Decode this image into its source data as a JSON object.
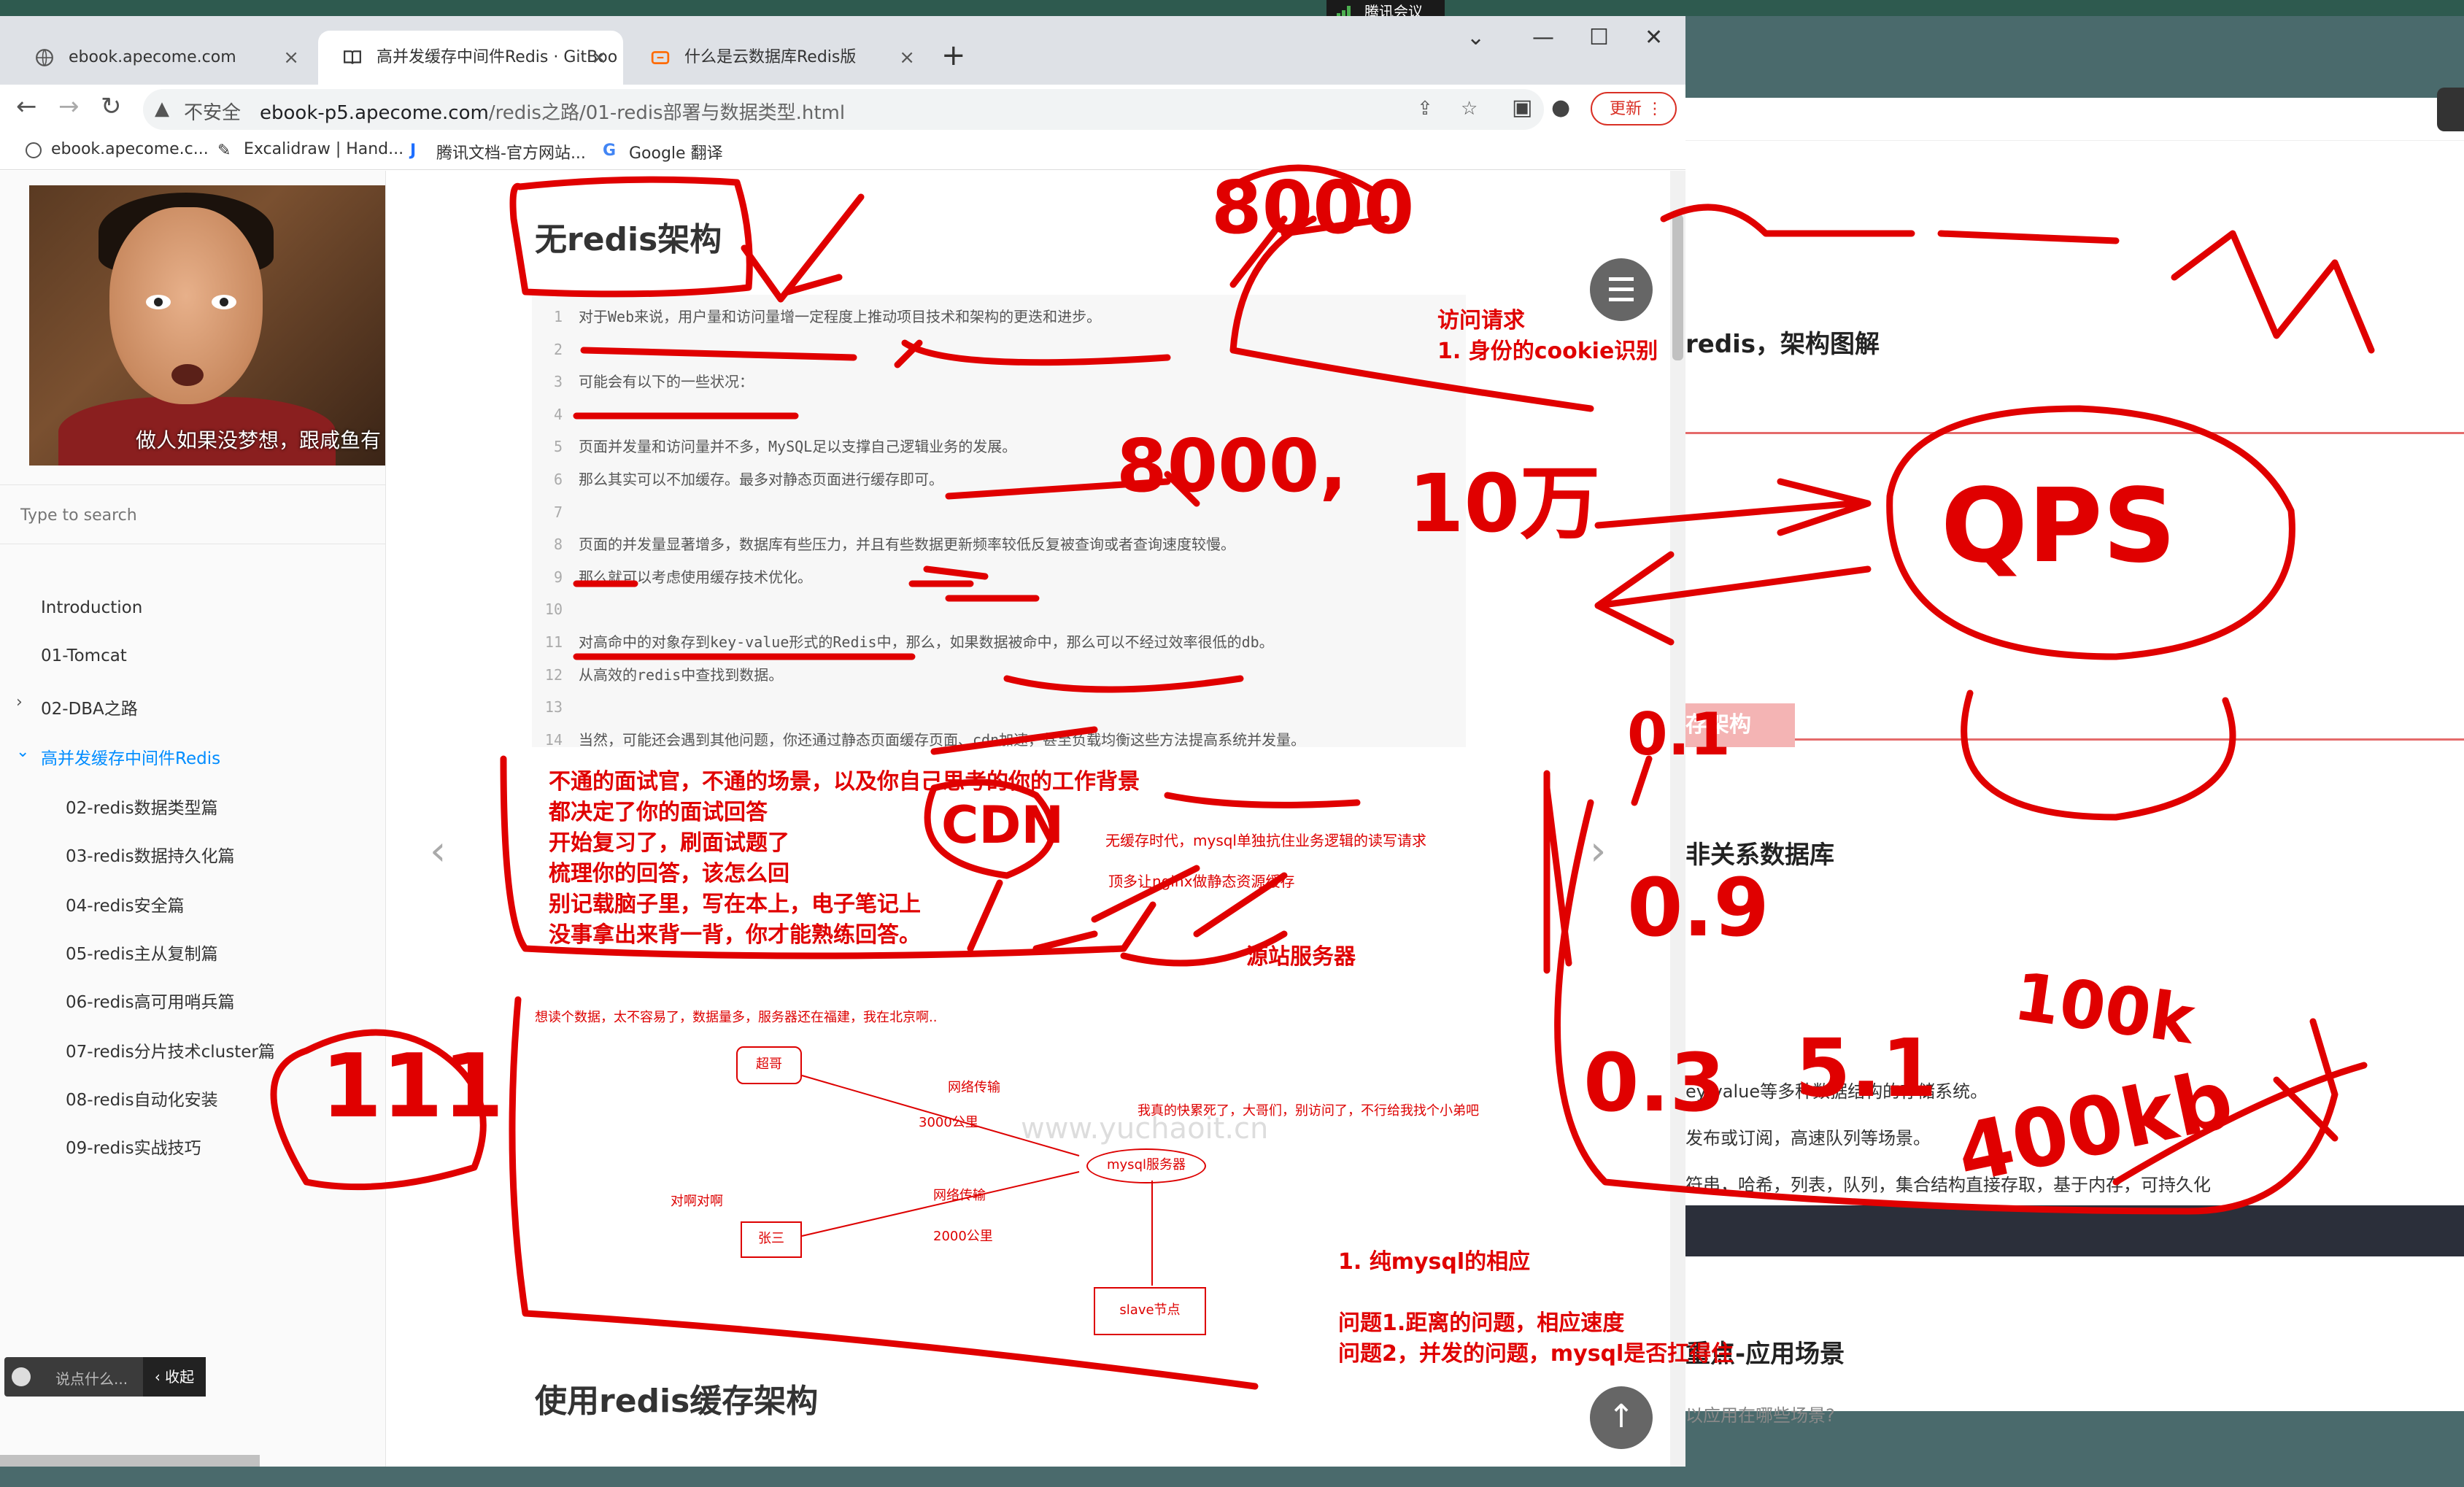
{
  "meeting": {
    "label": "腾讯会议"
  },
  "tabs": [
    {
      "label": "ebook.apecome.com",
      "icon": "globe-icon"
    },
    {
      "label": "高并发缓存中间件Redis · GitBoo",
      "icon": "book-icon",
      "active": true
    },
    {
      "label": "什么是云数据库Redis版",
      "icon": "aliyun-icon"
    }
  ],
  "toolbar": {
    "insecure": "不安全",
    "url_host": "ebook-p5.apecome.com",
    "url_path": "/redis之路/01-redis部署与数据类型.html",
    "update_label": "更新"
  },
  "bookmarks": [
    {
      "label": "ebook.apecome.c...",
      "icon": "globe-icon"
    },
    {
      "label": "Excalidraw | Hand...",
      "icon": "pen-icon"
    },
    {
      "label": "腾讯文档-官方网站...",
      "icon": "tencent-docs-icon"
    },
    {
      "label": "Google 翻译",
      "icon": "translate-icon"
    }
  ],
  "sidebar": {
    "avatar_caption": "做人如果没梦想，跟咸鱼有",
    "search_placeholder": "Type to search",
    "items": [
      {
        "label": "Introduction"
      },
      {
        "label": "01-Tomcat"
      },
      {
        "label": "02-DBA之路",
        "expandable": true
      },
      {
        "label": "高并发缓存中间件Redis",
        "active": true,
        "expanded": true
      },
      {
        "label": "02-redis数据类型篇"
      },
      {
        "label": "03-redis数据持久化篇"
      },
      {
        "label": "04-redis安全篇"
      },
      {
        "label": "05-redis主从复制篇"
      },
      {
        "label": "06-redis高可用哨兵篇"
      },
      {
        "label": "07-redis分片技术cluster篇"
      },
      {
        "label": "08-redis自动化安装"
      },
      {
        "label": "09-redis实战技巧"
      }
    ],
    "chat": {
      "placeholder": "说点什么...",
      "collapse": "收起"
    }
  },
  "main": {
    "title": "无redis架构",
    "code_lines": [
      {
        "n": "1",
        "text": "对于Web来说，用户量和访问量增一定程度上推动项目技术和架构的更迭和进步。"
      },
      {
        "n": "2",
        "text": ""
      },
      {
        "n": "3",
        "text": "可能会有以下的一些状况："
      },
      {
        "n": "4",
        "text": ""
      },
      {
        "n": "5",
        "text": "页面并发量和访问量并不多，MySQL足以支撑自己逻辑业务的发展。"
      },
      {
        "n": "6",
        "text": "那么其实可以不加缓存。最多对静态页面进行缓存即可。"
      },
      {
        "n": "7",
        "text": ""
      },
      {
        "n": "8",
        "text": "页面的并发量显著增多，数据库有些压力，并且有些数据更新频率较低反复被查询或者查询速度较慢。"
      },
      {
        "n": "9",
        "text": "那么就可以考虑使用缓存技术优化。"
      },
      {
        "n": "10",
        "text": ""
      },
      {
        "n": "11",
        "text": "对高命中的对象存到key-value形式的Redis中，那么，如果数据被命中，那么可以不经过效率很低的db。"
      },
      {
        "n": "12",
        "text": "从高效的redis中查找到数据。"
      },
      {
        "n": "13",
        "text": ""
      },
      {
        "n": "14",
        "text": "当然，可能还会遇到其他问题，你还通过静态页面缓存页面、cdn加速，甚至负载均衡这些方法提高系统并发量。"
      }
    ],
    "section2_title": "使用redis缓存架构",
    "diagram": {
      "top_text": "想读个数据，太不容易了，数据量多，服务器还在福建，我在北京啊..",
      "chaoge": "超哥",
      "net1": "网络传输",
      "dist1": "3000公里",
      "complain": "我真的快累死了，大哥们，别访问了，不行给我找个小弟吧",
      "watermark": "www.yuchaoit.cn",
      "mysql": "mysql服务器",
      "hey": "对啊对啊",
      "zhang": "张三",
      "net2": "网络传输",
      "dist2": "2000公里",
      "slave": "slave节点",
      "cdn_note1": "无缓存时代，mysql单独抗住业务逻辑的读写请求",
      "cdn_note2": "顶多让nginx做静态资源缓存"
    }
  },
  "right_window": {
    "arch_title": "redis，架构图解",
    "cache_arch": "存架构",
    "nosql": "非关系数据库",
    "kv_desc": "ey-value等多种数据结构的存储系统。",
    "pubsub": "发布或订阅，高速队列等场景。",
    "types": "符串，哈希，列表，队列，集合结构直接存取，基于内存，可持久化",
    "scenes": "重点-应用场景",
    "scenes_sub": "以应用在哪些场景?"
  },
  "annotations": {
    "visit_req": "访问请求",
    "cookie_id": "1. 身份的cookie识别",
    "interview": [
      "不通的面试官，不通的场景，以及你自己思考的你的工作背景",
      "都决定了你的面试回答",
      "开始复习了，刷面试题了",
      "梳理你的回答，该怎么回",
      "别记载脑子里，写在本上，电子笔记上",
      "没事拿出来背一背，你才能熟练回答。"
    ],
    "origin_server": "源站服务器",
    "mysql_resp": "1. 纯mysql的相应",
    "q1": "问题1.距离的问题，相应速度",
    "q2": "问题2，并发的问题，mysql是否扛得住",
    "scribble_8000": "8000",
    "scribble_8000b": "8000,",
    "scribble_10w": "10万",
    "scribble_qps": "QPS",
    "scribble_01": "0.1",
    "scribble_09": "0.9",
    "scribble_03": "0.3",
    "scribble_51": "5.1",
    "scribble_100k": "100k",
    "scribble_400k": "400kb",
    "scribble_111": "111",
    "scribble_cdn": "CDN"
  },
  "colors": {
    "accent": "#008cff",
    "annotation": "#e00000"
  }
}
